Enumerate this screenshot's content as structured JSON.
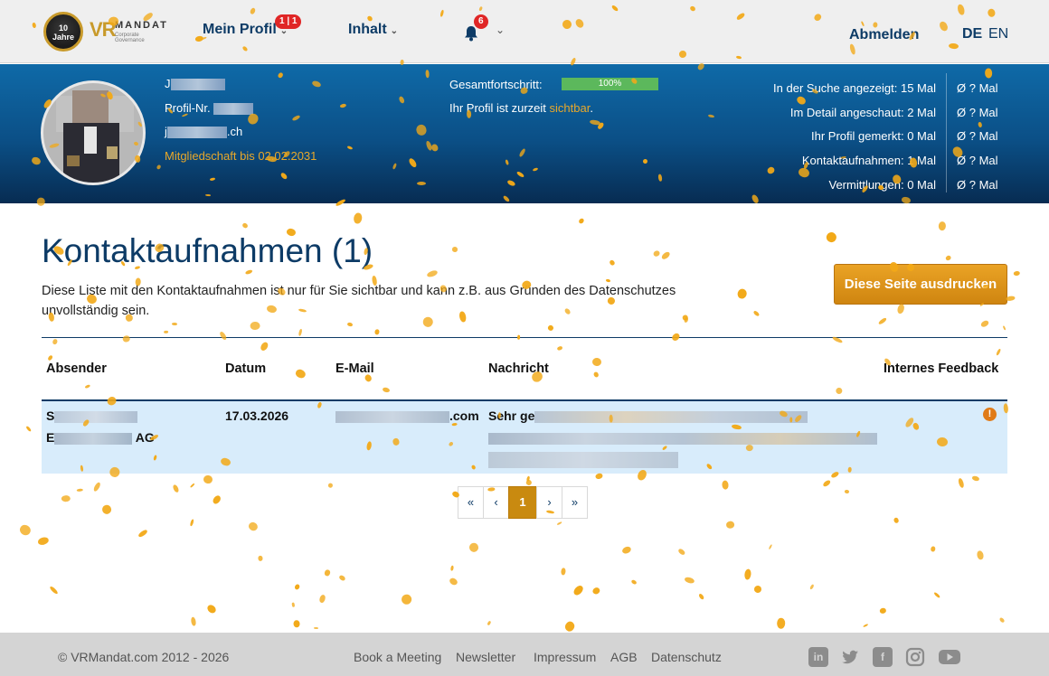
{
  "nav": {
    "logo_badge_line1": "10",
    "logo_badge_line2": "Jahre",
    "logo_vr": "VR",
    "logo_name": "MANDAT",
    "logo_sub": "Corporate Governance",
    "profile_label": "Mein Profil",
    "profile_badge": "1 | 1",
    "content_label": "Inhalt",
    "notification_count": "6",
    "logout_label": "Abmelden",
    "lang_de": "DE",
    "lang_en": "EN"
  },
  "profile": {
    "name_prefix": "J",
    "profile_nr_label": "Profil-Nr.",
    "email_prefix": "j",
    "email_suffix": ".ch",
    "membership": "Mitgliedschaft bis 02.02.2031",
    "progress_label": "Gesamtfortschritt:",
    "progress_value": "100%",
    "progress_fraction": 1.0,
    "visibility_text": "Ihr Profil ist zurzeit",
    "visibility_status": "sichtbar",
    "visibility_end": "."
  },
  "stats": [
    {
      "label": "In der Suche angezeigt: 15 Mal",
      "avg": "Ø  ?  Mal"
    },
    {
      "label": "Im Detail angeschaut: 2 Mal",
      "avg": "Ø  ?  Mal"
    },
    {
      "label": "Ihr Profil gemerkt: 0 Mal",
      "avg": "Ø  ?  Mal"
    },
    {
      "label": "Kontaktaufnahmen: 1 Mal",
      "avg": "Ø  ?  Mal"
    },
    {
      "label": "Vermittlungen: 0 Mal",
      "avg": "Ø  ?  Mal"
    }
  ],
  "main": {
    "title": "Kontaktaufnahmen (1)",
    "description": "Diese Liste mit den Kontaktaufnahmen ist nur für Sie sichtbar und kann z.B. aus Gründen des Datenschutzes unvollständig sein.",
    "print_button": "Diese Seite ausdrucken"
  },
  "table": {
    "headers": {
      "sender": "Absender",
      "date": "Datum",
      "email": "E-Mail",
      "message": "Nachricht",
      "feedback": "Internes Feedback"
    },
    "rows": [
      {
        "sender_line1": "S",
        "sender_line2_prefix": "E",
        "sender_line2_suffix": "AG",
        "date": "17.03.2026",
        "email_suffix": ".com",
        "message_prefix": "Sehr ge",
        "feedback_icon": "!"
      }
    ]
  },
  "pagination": {
    "first": "«",
    "prev": "‹",
    "current": "1",
    "next": "›",
    "last": "»"
  },
  "footer": {
    "copyright": "© VRMandat.com 2012 - 2026",
    "links": [
      "Book a Meeting",
      "Newsletter",
      "Impressum",
      "AGB",
      "Datenschutz"
    ],
    "social": [
      "linkedin-icon",
      "twitter-icon",
      "facebook-icon",
      "instagram-icon",
      "youtube-icon"
    ]
  },
  "colors": {
    "brand_navy": "#0d3b66",
    "accent_gold": "#e8a82a",
    "confetti": "#f2a918",
    "row_highlight": "#d8ecfb"
  }
}
